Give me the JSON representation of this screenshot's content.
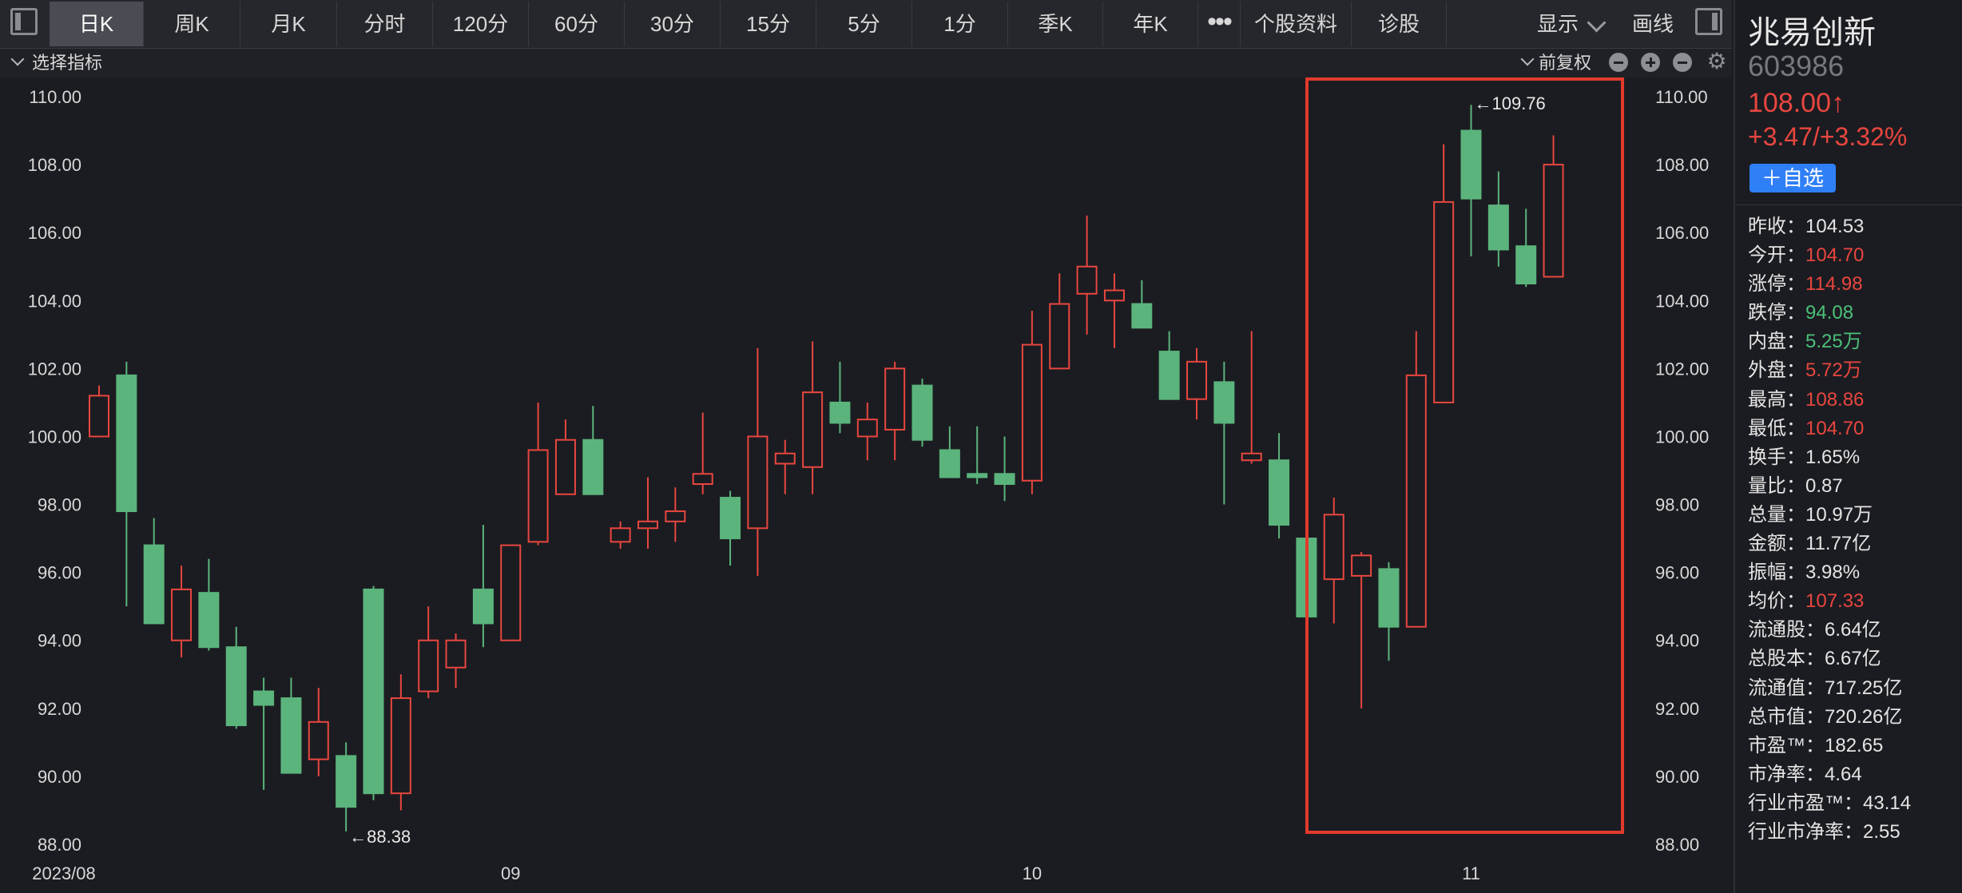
{
  "toolbar": {
    "tabs": [
      "日K",
      "周K",
      "月K",
      "分时",
      "120分",
      "60分",
      "30分",
      "15分",
      "5分",
      "1分",
      "季K",
      "年K"
    ],
    "more": "•••",
    "extra_tabs": [
      "个股资料",
      "诊股"
    ],
    "display_label": "显示",
    "draw_label": "画线"
  },
  "indicator_bar": {
    "label": "选择指标",
    "adjust_label": "前复权"
  },
  "stock": {
    "name": "兆易创新",
    "code": "603986",
    "price": "108.00↑",
    "change": "+3.47/+3.32%",
    "watch_label": "＋自选"
  },
  "stats": [
    {
      "label": "昨收：",
      "value": "104.53",
      "tone": "white"
    },
    {
      "label": "今开：",
      "value": "104.70",
      "tone": "red"
    },
    {
      "label": "涨停：",
      "value": "114.98",
      "tone": "red"
    },
    {
      "label": "跌停：",
      "value": "94.08",
      "tone": "green"
    },
    {
      "label": "内盘：",
      "value": "5.25万",
      "tone": "green"
    },
    {
      "label": "外盘：",
      "value": "5.72万",
      "tone": "red"
    },
    {
      "label": "最高：",
      "value": "108.86",
      "tone": "red"
    },
    {
      "label": "最低：",
      "value": "104.70",
      "tone": "red"
    },
    {
      "label": "换手：",
      "value": "1.65%",
      "tone": "white"
    },
    {
      "label": "量比：",
      "value": "0.87",
      "tone": "white"
    },
    {
      "label": "总量：",
      "value": "10.97万",
      "tone": "white"
    },
    {
      "label": "金额：",
      "value": "11.77亿",
      "tone": "white"
    },
    {
      "label": "振幅：",
      "value": "3.98%",
      "tone": "white"
    },
    {
      "label": "均价：",
      "value": "107.33",
      "tone": "red"
    },
    {
      "label": "流通股：",
      "value": "6.64亿",
      "tone": "white"
    },
    {
      "label": "总股本：",
      "value": "6.67亿",
      "tone": "white"
    },
    {
      "label": "流通值：",
      "value": "717.25亿",
      "tone": "white"
    },
    {
      "label": "总市值：",
      "value": "720.26亿",
      "tone": "white"
    },
    {
      "label": "市盈™：",
      "value": "182.65",
      "tone": "white"
    },
    {
      "label": "市净率：",
      "value": "4.64",
      "tone": "white"
    },
    {
      "label": "行业市盈™：",
      "value": "43.14",
      "tone": "white"
    },
    {
      "label": "行业市净率：",
      "value": "2.55",
      "tone": "white"
    }
  ],
  "colors": {
    "up": "#e8463f",
    "down": "#5bb47c",
    "highlight": "#e23a2c",
    "grid_text": "#d8d8d8"
  },
  "chart_data": {
    "type": "candlestick",
    "ylim": [
      88,
      110
    ],
    "y_ticks": [
      "110.00",
      "108.00",
      "106.00",
      "104.00",
      "102.00",
      "100.00",
      "98.00",
      "96.00",
      "94.00",
      "92.00",
      "90.00",
      "88.00"
    ],
    "x_tick_labels": [
      "2023/08",
      "09",
      "10",
      "11"
    ],
    "annotations": {
      "max": "←109.76",
      "min": "←88.38"
    },
    "candles": [
      {
        "date": "2023/08",
        "o": 100.0,
        "h": 101.5,
        "l": 100.0,
        "c": 101.2
      },
      {
        "date": "",
        "o": 101.8,
        "h": 102.2,
        "l": 95.0,
        "c": 97.8
      },
      {
        "date": "",
        "o": 96.8,
        "h": 97.6,
        "l": 94.5,
        "c": 94.5
      },
      {
        "date": "",
        "o": 94.0,
        "h": 96.2,
        "l": 93.5,
        "c": 95.5
      },
      {
        "date": "",
        "o": 95.4,
        "h": 96.4,
        "l": 93.7,
        "c": 93.8
      },
      {
        "date": "",
        "o": 93.8,
        "h": 94.4,
        "l": 91.4,
        "c": 91.5
      },
      {
        "date": "",
        "o": 92.5,
        "h": 92.9,
        "l": 89.6,
        "c": 92.1
      },
      {
        "date": "",
        "o": 92.3,
        "h": 92.9,
        "l": 90.1,
        "c": 90.1
      },
      {
        "date": "",
        "o": 90.5,
        "h": 92.6,
        "l": 90.0,
        "c": 91.6
      },
      {
        "date": "",
        "o": 90.6,
        "h": 91.0,
        "l": 88.38,
        "c": 89.1
      },
      {
        "date": "",
        "o": 95.5,
        "h": 95.6,
        "l": 89.3,
        "c": 89.5
      },
      {
        "date": "",
        "o": 89.5,
        "h": 93.0,
        "l": 89.0,
        "c": 92.3
      },
      {
        "date": "",
        "o": 92.5,
        "h": 95.0,
        "l": 92.3,
        "c": 94.0
      },
      {
        "date": "",
        "o": 93.2,
        "h": 94.2,
        "l": 92.6,
        "c": 94.0
      },
      {
        "date": "",
        "o": 95.5,
        "h": 97.4,
        "l": 93.8,
        "c": 94.5
      },
      {
        "date": "09",
        "o": 94.0,
        "h": 96.8,
        "l": 94.0,
        "c": 96.8
      },
      {
        "date": "",
        "o": 96.9,
        "h": 101.0,
        "l": 96.8,
        "c": 99.6
      },
      {
        "date": "",
        "o": 98.3,
        "h": 100.5,
        "l": 98.3,
        "c": 99.9
      },
      {
        "date": "",
        "o": 99.9,
        "h": 100.9,
        "l": 98.3,
        "c": 98.3
      },
      {
        "date": "",
        "o": 96.9,
        "h": 97.5,
        "l": 96.7,
        "c": 97.3
      },
      {
        "date": "",
        "o": 97.3,
        "h": 98.8,
        "l": 96.7,
        "c": 97.5
      },
      {
        "date": "",
        "o": 97.5,
        "h": 98.5,
        "l": 96.9,
        "c": 97.8
      },
      {
        "date": "",
        "o": 98.6,
        "h": 100.7,
        "l": 98.3,
        "c": 98.9
      },
      {
        "date": "",
        "o": 98.2,
        "h": 98.4,
        "l": 96.2,
        "c": 97.0
      },
      {
        "date": "",
        "o": 97.3,
        "h": 102.6,
        "l": 95.9,
        "c": 100.0
      },
      {
        "date": "",
        "o": 99.2,
        "h": 99.9,
        "l": 98.3,
        "c": 99.5
      },
      {
        "date": "",
        "o": 99.1,
        "h": 102.8,
        "l": 98.3,
        "c": 101.3
      },
      {
        "date": "",
        "o": 101.0,
        "h": 102.2,
        "l": 100.1,
        "c": 100.4
      },
      {
        "date": "",
        "o": 100.0,
        "h": 101.0,
        "l": 99.3,
        "c": 100.5
      },
      {
        "date": "",
        "o": 100.2,
        "h": 102.2,
        "l": 99.3,
        "c": 102.0
      },
      {
        "date": "",
        "o": 101.5,
        "h": 101.7,
        "l": 99.7,
        "c": 99.9
      },
      {
        "date": "",
        "o": 99.6,
        "h": 100.3,
        "l": 98.8,
        "c": 98.8
      },
      {
        "date": "",
        "o": 98.9,
        "h": 100.3,
        "l": 98.6,
        "c": 98.8
      },
      {
        "date": "",
        "o": 98.9,
        "h": 100.0,
        "l": 98.1,
        "c": 98.6
      },
      {
        "date": "10",
        "o": 98.7,
        "h": 103.7,
        "l": 98.3,
        "c": 102.7
      },
      {
        "date": "",
        "o": 102.0,
        "h": 104.8,
        "l": 102.0,
        "c": 103.9
      },
      {
        "date": "",
        "o": 104.2,
        "h": 106.5,
        "l": 103.0,
        "c": 105.0
      },
      {
        "date": "",
        "o": 104.0,
        "h": 104.8,
        "l": 102.6,
        "c": 104.3
      },
      {
        "date": "",
        "o": 103.9,
        "h": 104.6,
        "l": 103.2,
        "c": 103.2
      },
      {
        "date": "",
        "o": 102.5,
        "h": 103.1,
        "l": 101.1,
        "c": 101.1
      },
      {
        "date": "",
        "o": 101.1,
        "h": 102.6,
        "l": 100.5,
        "c": 102.2
      },
      {
        "date": "",
        "o": 101.6,
        "h": 102.2,
        "l": 98.0,
        "c": 100.4
      },
      {
        "date": "",
        "o": 99.3,
        "h": 103.1,
        "l": 99.2,
        "c": 99.5
      },
      {
        "date": "",
        "o": 99.3,
        "h": 100.1,
        "l": 97.0,
        "c": 97.4
      },
      {
        "date": "",
        "o": 97.0,
        "h": 97.6,
        "l": 93.6,
        "c": 94.7
      },
      {
        "date": "",
        "o": 95.8,
        "h": 98.2,
        "l": 94.5,
        "c": 97.7
      },
      {
        "date": "",
        "o": 95.9,
        "h": 96.6,
        "l": 92.0,
        "c": 96.5
      },
      {
        "date": "",
        "o": 96.1,
        "h": 96.3,
        "l": 93.4,
        "c": 94.4
      },
      {
        "date": "",
        "o": 94.4,
        "h": 103.1,
        "l": 94.4,
        "c": 101.8
      },
      {
        "date": "",
        "o": 101.0,
        "h": 108.6,
        "l": 101.0,
        "c": 106.9
      },
      {
        "date": "11",
        "o": 109.0,
        "h": 109.76,
        "l": 105.3,
        "c": 107.0
      },
      {
        "date": "",
        "o": 106.8,
        "h": 107.8,
        "l": 105.0,
        "c": 105.5
      },
      {
        "date": "",
        "o": 105.6,
        "h": 106.7,
        "l": 104.4,
        "c": 104.5
      },
      {
        "date": "",
        "o": 104.7,
        "h": 108.86,
        "l": 104.7,
        "c": 108.0
      }
    ]
  }
}
